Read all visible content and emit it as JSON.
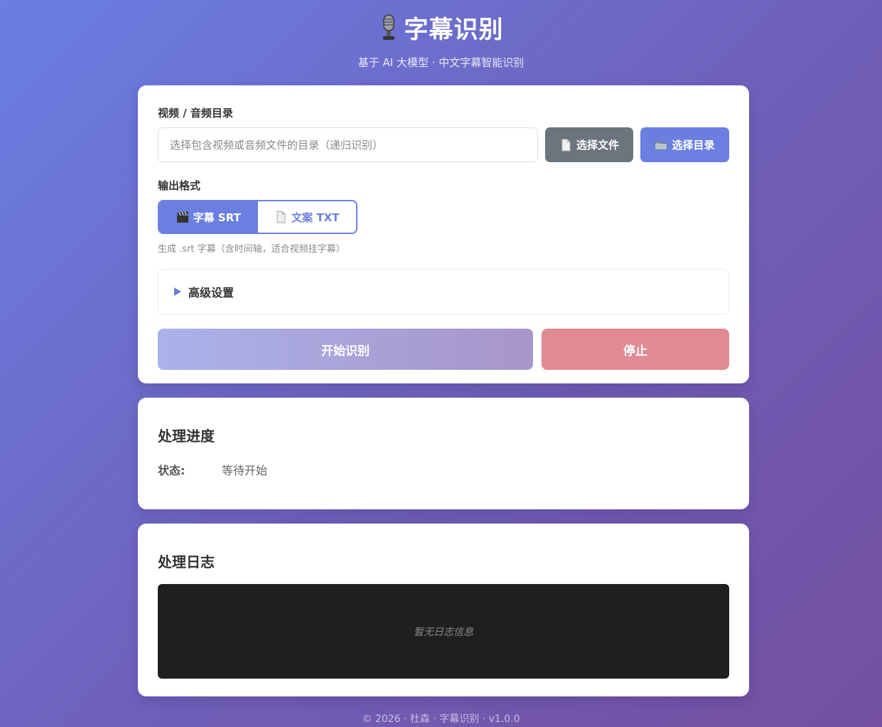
{
  "header": {
    "title": "字幕识别",
    "subtitle": "基于 AI 大模型 · 中文字幕智能识别",
    "icon": "microphone-icon"
  },
  "source": {
    "label": "视频 / 音频目录",
    "placeholder": "选择包含视频或音频文件的目录（递归识别）",
    "value": "",
    "select_file_label": "选择文件",
    "select_dir_label": "选择目录"
  },
  "format": {
    "label": "输出格式",
    "options": [
      {
        "label": "字幕 SRT",
        "icon": "clapper-icon",
        "active": true
      },
      {
        "label": "文案 TXT",
        "icon": "document-icon",
        "active": false
      }
    ],
    "hint": "生成 .srt 字幕（含时间轴，适合视频挂字幕）"
  },
  "advanced": {
    "label": "高级设置"
  },
  "actions": {
    "start_label": "开始识别",
    "stop_label": "停止"
  },
  "progress": {
    "title": "处理进度",
    "status_key": "状态:",
    "status_value": "等待开始"
  },
  "log": {
    "title": "处理日志",
    "empty_text": "暂无日志信息"
  },
  "footer": {
    "text": "© 2026 · 杜森 · 字幕识别 · v1.0.0"
  },
  "colors": {
    "accent": "#6a7fe0",
    "file_button": "#6c757d",
    "stop_button": "#e08a92",
    "log_background": "#1f1f1f"
  }
}
